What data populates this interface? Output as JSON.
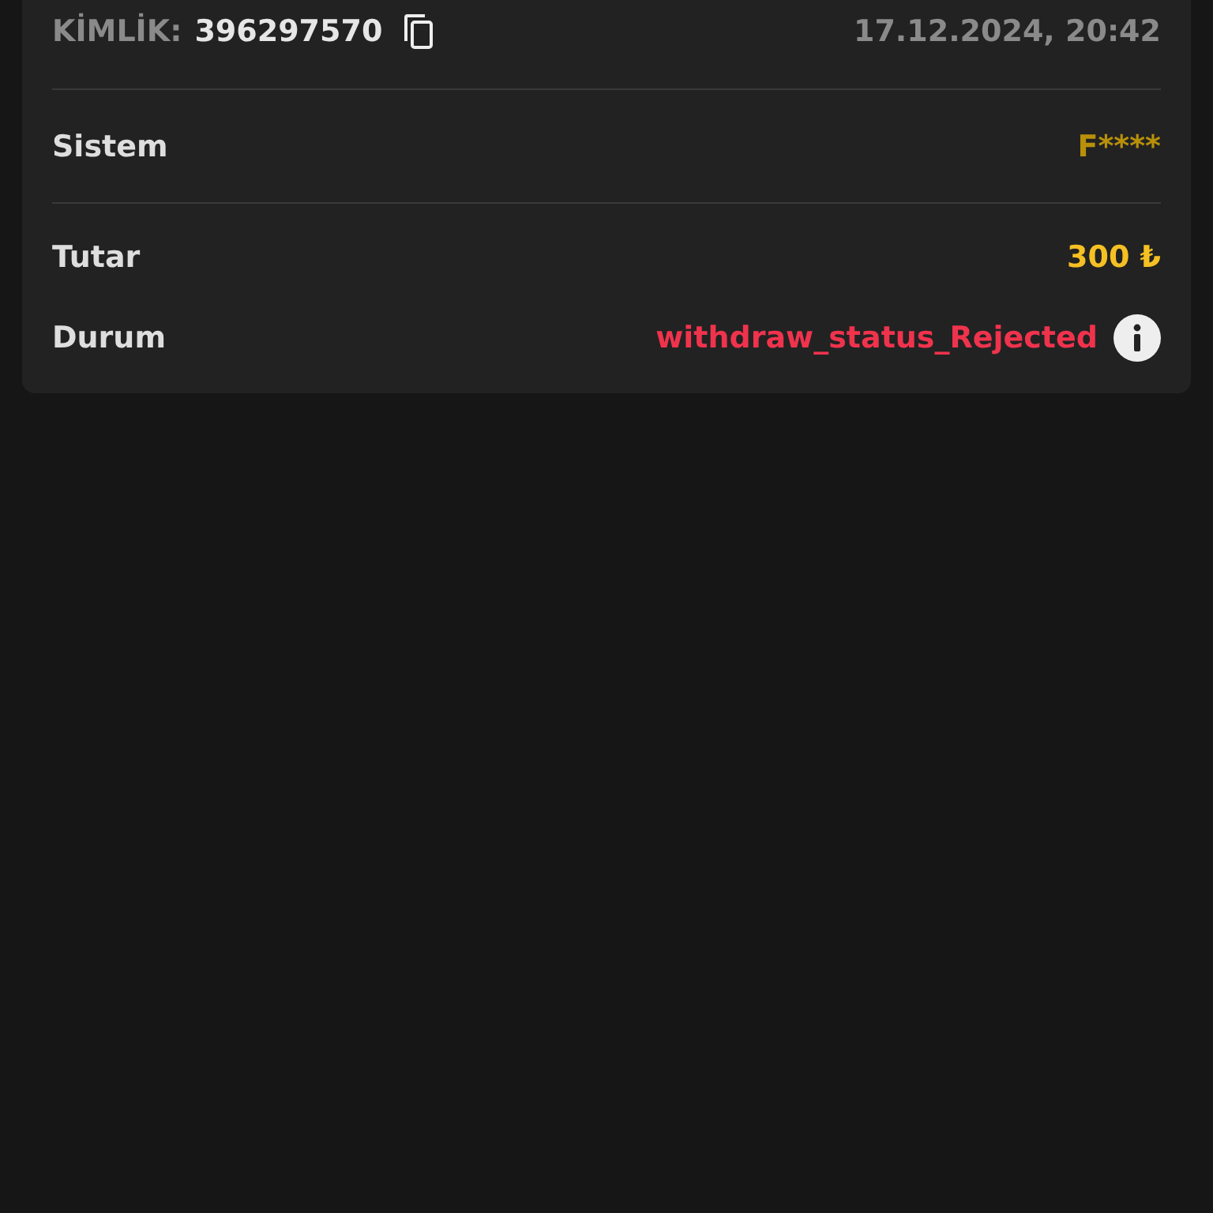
{
  "header": {
    "id_label": "KİMLİK:",
    "id_value": "396297570",
    "date": "17.12.2024, 20:42"
  },
  "system": {
    "label": "Sistem",
    "value": "F****"
  },
  "details": [
    {
      "kind": "amount",
      "label": "Tutar",
      "value": "300 ₺"
    },
    {
      "kind": "status",
      "label": "Durum",
      "value": "withdraw_status_Rejected"
    }
  ]
}
